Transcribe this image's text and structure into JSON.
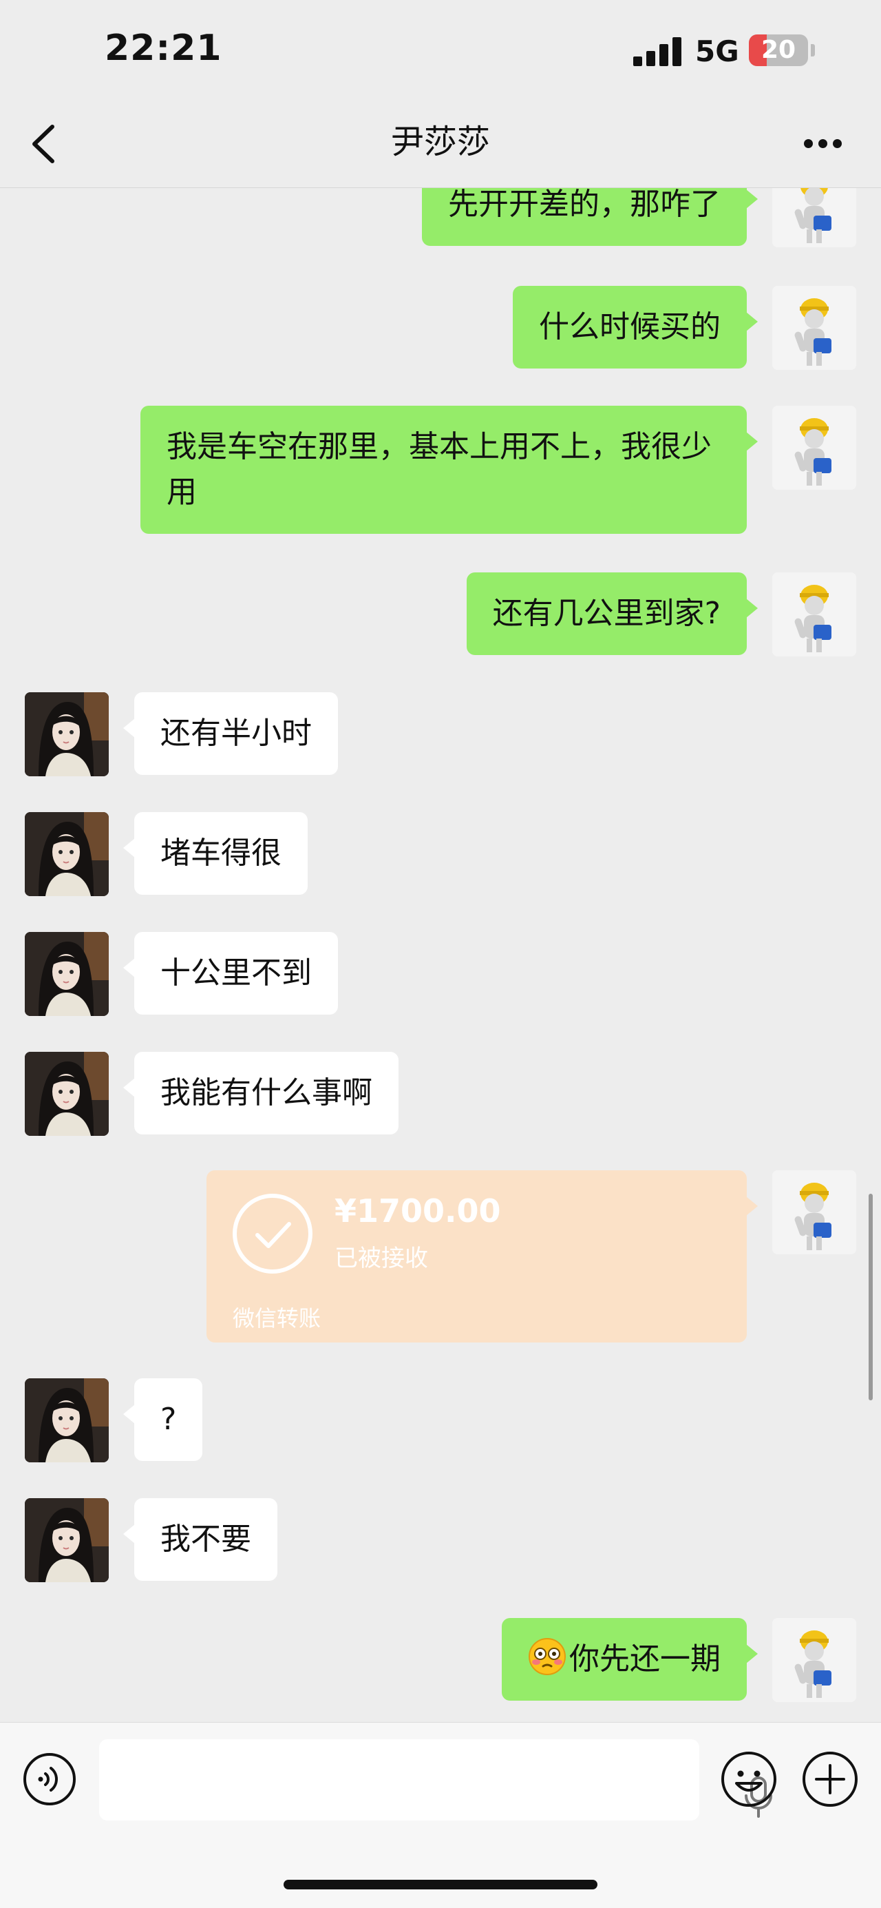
{
  "status_bar": {
    "time": "22:21",
    "network": "5G",
    "battery": "20"
  },
  "header": {
    "title": "尹莎莎"
  },
  "messages": [
    {
      "from": "me",
      "type": "text",
      "text": "先开开差的，那咋了"
    },
    {
      "from": "me",
      "type": "text",
      "text": "什么时候买的"
    },
    {
      "from": "me",
      "type": "text",
      "text": "我是车空在那里，基本上用不上，我很少用"
    },
    {
      "from": "me",
      "type": "text",
      "text": "还有几公里到家?"
    },
    {
      "from": "her",
      "type": "text",
      "text": "还有半小时"
    },
    {
      "from": "her",
      "type": "text",
      "text": "堵车得很"
    },
    {
      "from": "her",
      "type": "text",
      "text": "十公里不到"
    },
    {
      "from": "her",
      "type": "text",
      "text": "我能有什么事啊"
    },
    {
      "from": "me",
      "type": "transfer",
      "amount": "¥1700.00",
      "status": "已被接收",
      "brand": "微信转账"
    },
    {
      "from": "her",
      "type": "text",
      "text": "?"
    },
    {
      "from": "her",
      "type": "text",
      "text": "我不要"
    },
    {
      "from": "me",
      "type": "text",
      "text": "你先还一期"
    }
  ],
  "icons": {
    "back": "chevron-left-icon",
    "more": "more-dots-icon",
    "voice": "voice-input-icon",
    "mic": "microphone-icon",
    "emoji": "emoji-icon",
    "plus": "plus-icon",
    "transfer": "check-circle-icon",
    "sticker": "flushed-face-emoji"
  },
  "colors": {
    "outgoing_bubble": "#95ec69",
    "incoming_bubble": "#ffffff",
    "transfer_card": "#fbe1c7",
    "background": "#ededed"
  }
}
